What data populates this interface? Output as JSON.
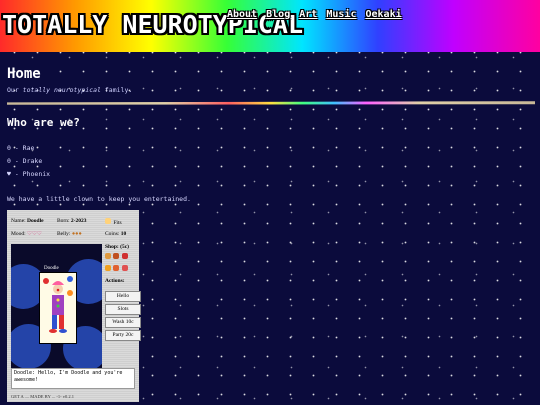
{
  "header": {
    "logo": "TOTALLY NEUROTYPICAL",
    "nav": [
      "About",
      "Blog",
      "Art",
      "Music",
      "Oekaki"
    ]
  },
  "page": {
    "title": "Home",
    "tagline_prefix": "Our",
    "tagline_emph": "totally neurotypical",
    "tagline_suffix": "family.",
    "section_title": "Who are we?",
    "members": [
      {
        "symbol": "0",
        "name": "- Rae"
      },
      {
        "symbol": "0",
        "name": "- Drake"
      },
      {
        "symbol": "♥",
        "name": "- Phoenix"
      }
    ],
    "intro": "We have a little clown to keep you entertained."
  },
  "pet": {
    "name_label": "Name:",
    "name_value": "Doodle",
    "born_label": "Born:",
    "born_value": "2-2023",
    "fits_label": "Fits",
    "mood_label": "Mood:",
    "mood_value": "♡♡♡",
    "belly_label": "Belly:",
    "belly_value": "●●●",
    "coins_label": "Coins:",
    "coins_value": "10",
    "image_name": "Doodle",
    "shop_label": "Shop: (5c)",
    "actions_label": "Actions:",
    "actions": [
      "Hello",
      "Slots",
      "Wash 10c",
      "Party 20c"
    ],
    "message": "Doodle: Hello, I'm Doodle and you're awesome!",
    "footer": "GET A .... MADE BY ... -1- v0.2.1"
  },
  "colors": {
    "background": "#0b0b3c",
    "accent": "#ffffff"
  }
}
